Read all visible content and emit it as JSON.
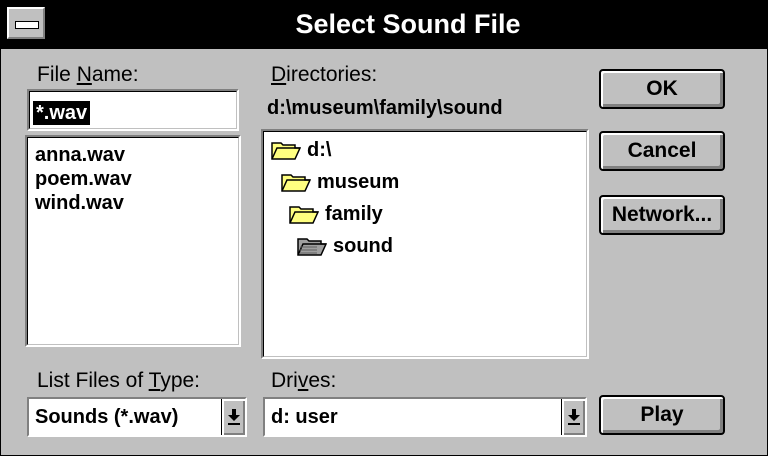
{
  "window": {
    "title": "Select Sound File"
  },
  "file_name": {
    "label_pre": "File ",
    "label_accel": "N",
    "label_post": "ame:",
    "value": "*.wav",
    "files": [
      "anna.wav",
      "poem.wav",
      "wind.wav"
    ]
  },
  "directories": {
    "label_accel": "D",
    "label_post": "irectories:",
    "current_path": "d:\\museum\\family\\sound",
    "tree": [
      "d:\\",
      "museum",
      "family",
      "sound"
    ]
  },
  "file_type": {
    "label_pre": "List Files of ",
    "label_accel": "T",
    "label_post": "ype:",
    "selected": "Sounds (*.wav)"
  },
  "drives": {
    "label_pre": "Dri",
    "label_accel": "v",
    "label_post": "es:",
    "selected": "d: user"
  },
  "buttons": {
    "ok": "OK",
    "cancel": "Cancel",
    "network": "Network...",
    "play": "Play"
  },
  "colors": {
    "face": "#c0c0c0",
    "titlebar": "#000000",
    "selection": "#000000",
    "folder": "#ffff80"
  },
  "icons": {
    "open_folder": "open-folder-icon",
    "selected_folder": "selected-folder-icon",
    "dropdown": "down-arrow-icon"
  }
}
